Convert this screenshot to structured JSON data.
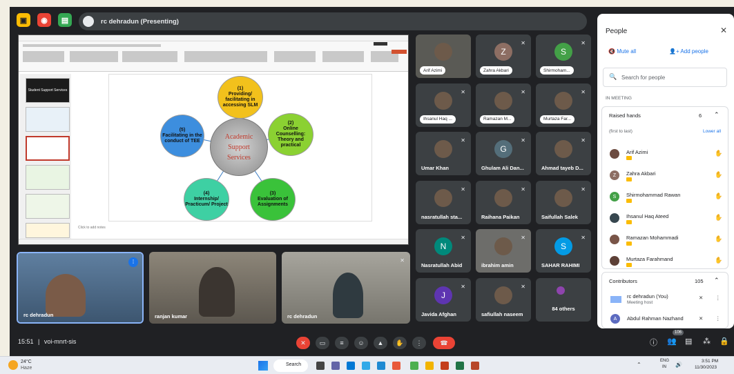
{
  "meeting": {
    "presenting_label": "rc dehradun (Presenting)",
    "time": "15:51",
    "separator": "|",
    "code": "voi-mnrt-sis"
  },
  "slide": {
    "center_lines": [
      "Academic",
      "Support",
      "Services"
    ],
    "bubbles": [
      {
        "num": "(1)",
        "text": "Providing/ facilitating in accessing SLM",
        "color": "#f2c11c"
      },
      {
        "num": "(2)",
        "text": "Online Counselling: Theory and practical",
        "color": "#8bd132"
      },
      {
        "num": "(3)",
        "text": "Evaluation of Assignments",
        "color": "#3ac23a"
      },
      {
        "num": "(4)",
        "text": "Internship/ Practicum/ Project",
        "color": "#3ed0a3"
      },
      {
        "num": "(5)",
        "text": "Facilitating in the conduct of TEE",
        "color": "#3d8ede"
      }
    ],
    "notes": "Click to add notes",
    "thumb_title": "Student Support Services"
  },
  "participants": [
    {
      "name": "Arif Azimi",
      "style": "pill",
      "bg": "#5a5a55"
    },
    {
      "name": "Zahra Akbari",
      "style": "pill",
      "initial": "Z",
      "avatar": "#8d6e63"
    },
    {
      "name": "Shirmoham...",
      "style": "pill",
      "initial": "S",
      "avatar": "#43a047"
    },
    {
      "name": "Ihsanul Haq ...",
      "style": "pill",
      "bg": "#3c4043"
    },
    {
      "name": "Ramazan M...",
      "style": "pill",
      "bg": "#3c4043"
    },
    {
      "name": "Murtaza Far...",
      "style": "pill",
      "bg": "#3c4043"
    },
    {
      "name": "Umar Khan",
      "style": "text",
      "bg": "#3c4043"
    },
    {
      "name": "Ghulam Ali Dan...",
      "style": "text",
      "initial": "G",
      "avatar": "#546e7a"
    },
    {
      "name": "Ahmad tayeb D...",
      "style": "text",
      "bg": "#3c4043"
    },
    {
      "name": "nasratullah sta...",
      "style": "text",
      "bg": "#3c4043"
    },
    {
      "name": "Raihana Paikan",
      "style": "text",
      "bg": "#3c4043"
    },
    {
      "name": "Saifullah Salek",
      "style": "text",
      "bg": "#3c4043"
    },
    {
      "name": "Nasratullah Abid",
      "style": "text",
      "initial": "N",
      "avatar": "#00897b"
    },
    {
      "name": "ibrahim amin",
      "style": "text",
      "bg": "#6d6d6a"
    },
    {
      "name": "SAHAR RAHIMI",
      "style": "text",
      "initial": "S",
      "avatar": "#039be5"
    },
    {
      "name": "Javida Afghan",
      "style": "text",
      "initial": "J",
      "avatar": "#5e35b1"
    },
    {
      "name": "safiullah naseem",
      "style": "text",
      "bg": "#3c4043"
    },
    {
      "name": "84 others",
      "style": "others",
      "bg": "#3c4043"
    }
  ],
  "videos": [
    {
      "name": "rc dehradun",
      "bg": "#4e6b8a"
    },
    {
      "name": "ranjan kumar",
      "bg": "#7a7468"
    },
    {
      "name": "rc dehradun",
      "bg": "#8d8b82"
    }
  ],
  "people_panel": {
    "title": "People",
    "mute_all": "Mute all",
    "add_people": "Add people",
    "search_placeholder": "Search for people",
    "in_meeting": "IN MEETING",
    "raised_hands_label": "Raised hands",
    "raised_hands_count": "6",
    "order_label": "(first to last)",
    "lower_all": "Lower all",
    "raised": [
      {
        "name": "Arif Azimi",
        "color": "#6d4c41"
      },
      {
        "name": "Zahra Akbari",
        "initial": "Z",
        "color": "#8d6e63"
      },
      {
        "name": "Shirmohammad Rawan",
        "initial": "S",
        "color": "#43a047"
      },
      {
        "name": "Ihsanul Haq Ateed",
        "color": "#37474f"
      },
      {
        "name": "Ramazan Mohammadi",
        "color": "#795548"
      },
      {
        "name": "Murtaza Farahmand",
        "color": "#5d4037"
      }
    ],
    "contributors_label": "Contributors",
    "contributors_count": "105",
    "contributors": [
      {
        "name": "rc dehradun (You)",
        "sub": "Meeting host"
      },
      {
        "name": "Abdul Rahman Nazhand",
        "initial": "A",
        "color": "#5c6bc0"
      }
    ]
  },
  "people_badge": "106",
  "taskbar": {
    "weather_temp": "24°C",
    "weather_desc": "Haze",
    "search": "Search",
    "lang1": "ENG",
    "lang2": "IN",
    "clock_time": "3:51 PM",
    "clock_date": "11/30/2023"
  }
}
